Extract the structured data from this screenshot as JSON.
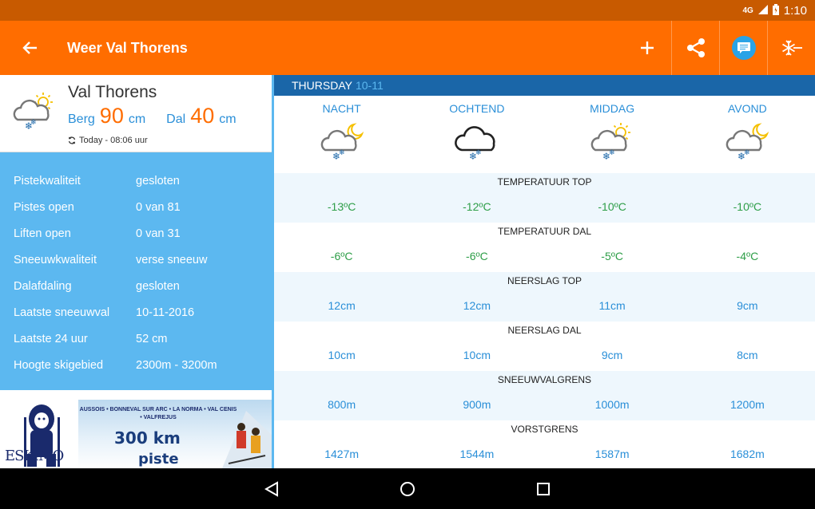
{
  "status": {
    "network": "4G",
    "time": "1:10"
  },
  "app_bar": {
    "title": "Weer Val Thorens"
  },
  "resort": {
    "name": "Val Thorens",
    "berg_label": "Berg",
    "berg_value": "90",
    "berg_unit": "cm",
    "dal_label": "Dal",
    "dal_value": "40",
    "dal_unit": "cm",
    "updated": "Today - 08:06 uur"
  },
  "stats": [
    {
      "label": "Pistekwaliteit",
      "value": "gesloten"
    },
    {
      "label": "Pistes open",
      "value": "0 van 81"
    },
    {
      "label": "Liften open",
      "value": "0 van 31"
    },
    {
      "label": "Sneeuwkwaliteit",
      "value": "verse sneeuw"
    },
    {
      "label": "Dalafdaling",
      "value": "gesloten"
    },
    {
      "label": "Laatste sneeuwval",
      "value": "10-11-2016"
    },
    {
      "label": "Laatste 24 uur",
      "value": "52 cm"
    },
    {
      "label": "Hoogte skigebied",
      "value": "2300m - 3200m"
    }
  ],
  "ad": {
    "towns": "AUSSOIS • BONNEVAL SUR ARC • LA NORMA • VAL CENIS • VALFREJUS",
    "headline": "300 km",
    "subline": "piste",
    "brand": "ESKIMO"
  },
  "forecast": {
    "day": "THURSDAY",
    "date": "10-11",
    "periods": [
      {
        "name": "NACHT",
        "icon": "night-cloud-snow-icon"
      },
      {
        "name": "OCHTEND",
        "icon": "cloud-snow-icon"
      },
      {
        "name": "MIDDAG",
        "icon": "sun-cloud-snow-icon"
      },
      {
        "name": "AVOND",
        "icon": "night-cloud-snow-icon"
      }
    ],
    "sections": [
      {
        "title": "TEMPERATUUR TOP",
        "values": [
          "-13ºC",
          "-12ºC",
          "-10ºC",
          "-10ºC"
        ]
      },
      {
        "title": "TEMPERATUUR DAL",
        "values": [
          "-6ºC",
          "-6ºC",
          "-5ºC",
          "-4ºC"
        ]
      },
      {
        "title": "NEERSLAG TOP",
        "values": [
          "12cm",
          "12cm",
          "11cm",
          "9cm"
        ]
      },
      {
        "title": "NEERSLAG DAL",
        "values": [
          "10cm",
          "10cm",
          "9cm",
          "8cm"
        ]
      },
      {
        "title": "SNEEUWVALGRENS",
        "values": [
          "800m",
          "900m",
          "1000m",
          "1200m"
        ]
      },
      {
        "title": "VORSTGRENS",
        "values": [
          "1427m",
          "1544m",
          "1587m",
          "1682m"
        ]
      }
    ]
  },
  "colors": {
    "orange": "#ff6d00",
    "blue": "#2a8fd8",
    "panel": "#5cb8f0",
    "dark_blue": "#1a66a8",
    "green": "#2e9e48"
  }
}
